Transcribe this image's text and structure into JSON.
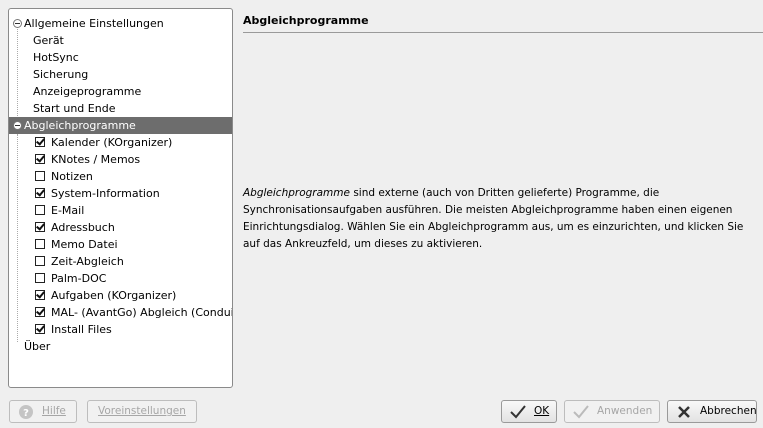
{
  "tree": {
    "general": {
      "label": "Allgemeine Einstellungen",
      "children": [
        "Gerät",
        "HotSync",
        "Sicherung",
        "Anzeigeprogramme",
        "Start und Ende"
      ]
    },
    "conduits": {
      "label": "Abgleichprogramme",
      "items": [
        {
          "label": "Kalender (KOrganizer)",
          "checked": true
        },
        {
          "label": "KNotes / Memos",
          "checked": true
        },
        {
          "label": "Notizen",
          "checked": false
        },
        {
          "label": "System-Information",
          "checked": true
        },
        {
          "label": "E-Mail",
          "checked": false
        },
        {
          "label": "Adressbuch",
          "checked": true
        },
        {
          "label": "Memo Datei",
          "checked": false
        },
        {
          "label": "Zeit-Abgleich",
          "checked": false
        },
        {
          "label": "Palm-DOC",
          "checked": false
        },
        {
          "label": "Aufgaben (KOrganizer)",
          "checked": true
        },
        {
          "label": "MAL- (AvantGo) Abgleich (Conduit)",
          "checked": true
        },
        {
          "label": "Install Files",
          "checked": true
        }
      ]
    },
    "about": "Über"
  },
  "content": {
    "title": "Abgleichprogramme",
    "desc_em": "Abgleichprogramme",
    "desc_rest": " sind externe (auch von Dritten gelieferte) Programme, die Synchronisationsaufgaben ausführen. Die meisten Abgleichprogramme haben einen eigenen Einrichtungsdialog. Wählen Sie ein Abgleichprogramm aus, um es einzurichten, und klicken Sie auf das Ankreuzfeld, um dieses zu aktivieren."
  },
  "buttons": {
    "help": "Hilfe",
    "defaults": "Voreinstellungen",
    "ok": "OK",
    "apply": "Anwenden",
    "cancel": "Abbrechen"
  },
  "colors": {
    "selection": "#6d6d6d",
    "background": "#efefef"
  }
}
